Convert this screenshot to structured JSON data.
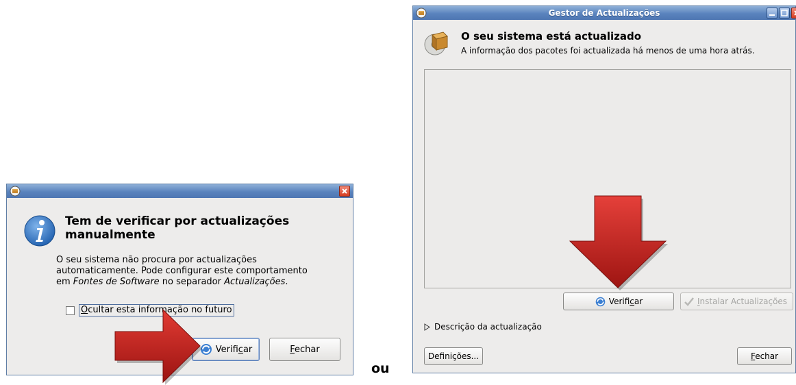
{
  "dialog": {
    "heading_line1": "Tem de verificar por actualizações",
    "heading_line2": "manualmente",
    "body_line1": "O seu sistema não procura por actualizações",
    "body_line2": "automaticamente. Pode configurar este comportamento",
    "body_line3_prefix": "em ",
    "body_line3_em1": "Fontes de Software",
    "body_line3_mid": " no separador ",
    "body_line3_em2": "Actualizações",
    "body_line3_suffix": ".",
    "checkbox": {
      "label_key": "O",
      "label_rest": "cultar esta informação no futuro",
      "checked": false
    },
    "check_button": {
      "label_pre": "Verifi",
      "label_key": "c",
      "label_post": "ar"
    },
    "close_button": {
      "label_key": "F",
      "label_rest": "echar"
    }
  },
  "separator_text": "ou",
  "update_manager": {
    "title": "Gestor de Actualizações",
    "status_title": "O seu sistema está actualizado",
    "status_detail": "A informação dos pacotes foi actualizada há menos de uma hora atrás.",
    "check_button": {
      "label_pre": "Verifi",
      "label_key": "c",
      "label_post": "ar"
    },
    "install_button": {
      "label_key": "I",
      "label_rest": "nstalar Actualizações",
      "enabled": false
    },
    "description_expander": "Descrição da actualização",
    "settings_button": "Definições...",
    "close_button": {
      "label_key": "F",
      "label_rest": "echar"
    }
  },
  "colors": {
    "arrow_red": "#c8201e",
    "titlebar_blue": "#5a83bd",
    "info_icon_blue": "#2a6fbd"
  }
}
